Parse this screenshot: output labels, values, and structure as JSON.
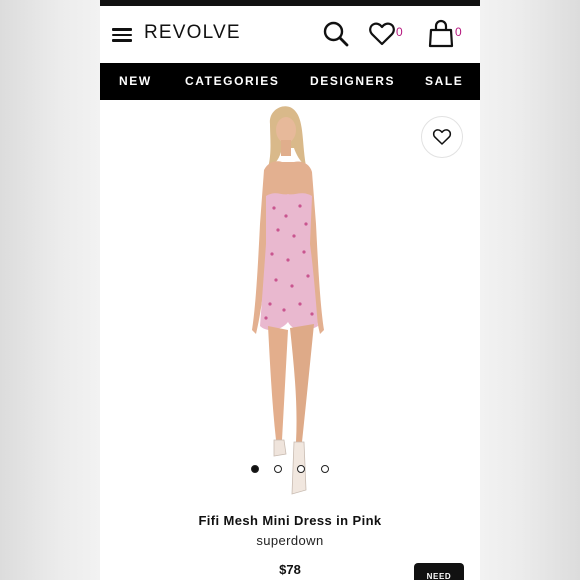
{
  "header": {
    "logo": "REVOLVE",
    "wishlist_count": "0",
    "bag_count": "0",
    "menu_icon": "hamburger-menu-icon",
    "search_icon": "search-icon",
    "wishlist_icon": "heart-icon",
    "bag_icon": "shopping-bag-icon",
    "accent_color": "#b5177e"
  },
  "nav": {
    "items": [
      "NEW",
      "CATEGORIES",
      "DESIGNERS",
      "SALE"
    ]
  },
  "product": {
    "title": "Fifi Mesh Mini Dress in Pink",
    "brand": "superdown",
    "price": "$78",
    "wishlist_button_icon": "heart-outline-icon",
    "gallery": {
      "total": 4,
      "active_index": 0
    }
  },
  "help_button": {
    "label": "NEED"
  }
}
